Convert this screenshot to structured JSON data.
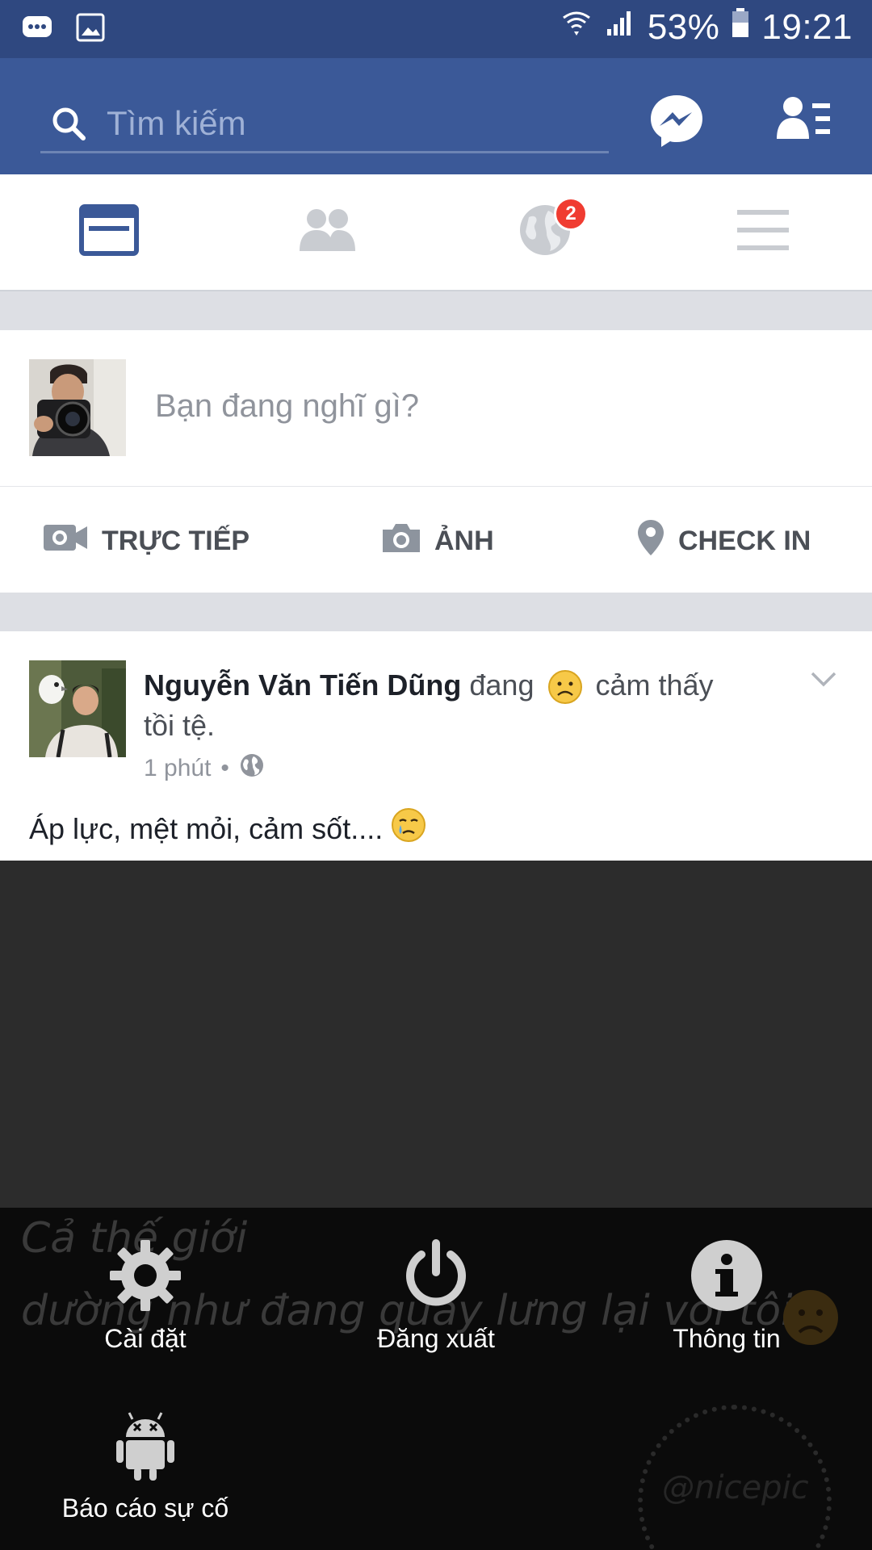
{
  "status_bar": {
    "battery": "53%",
    "time": "19:21"
  },
  "search": {
    "placeholder": "Tìm kiếm"
  },
  "tabs": [
    {
      "name": "news-feed",
      "active": true
    },
    {
      "name": "friend-requests",
      "active": false
    },
    {
      "name": "notifications",
      "active": false,
      "badge": "2"
    },
    {
      "name": "more-menu",
      "active": false
    }
  ],
  "composer": {
    "placeholder": "Bạn đang nghĩ gì?"
  },
  "actions": {
    "live": "TRỰC TIẾP",
    "photo": "ẢNH",
    "checkin": "CHECK IN"
  },
  "post": {
    "author": "Nguyễn Văn Tiến Dũng",
    "verb": "đang",
    "feeling_suffix": " cảm thấy tồi tệ.",
    "time": "1 phút",
    "separator": "•",
    "text": "Áp lực, mệt mỏi, cảm sốt...."
  },
  "overlay_menu": {
    "settings": "Cài đặt",
    "logout": "Đăng xuất",
    "info": "Thông tin",
    "report": "Báo cáo sự cố"
  },
  "watermark": {
    "line1": "Cả thế giới",
    "line2": "dường như đang quay lưng lại với tôi",
    "tag": "@nicepic"
  },
  "colors": {
    "brand": "#3b5998",
    "statusbar": "#2f4880",
    "badge": "#f03c31",
    "overlay": "#0b0b0b"
  }
}
